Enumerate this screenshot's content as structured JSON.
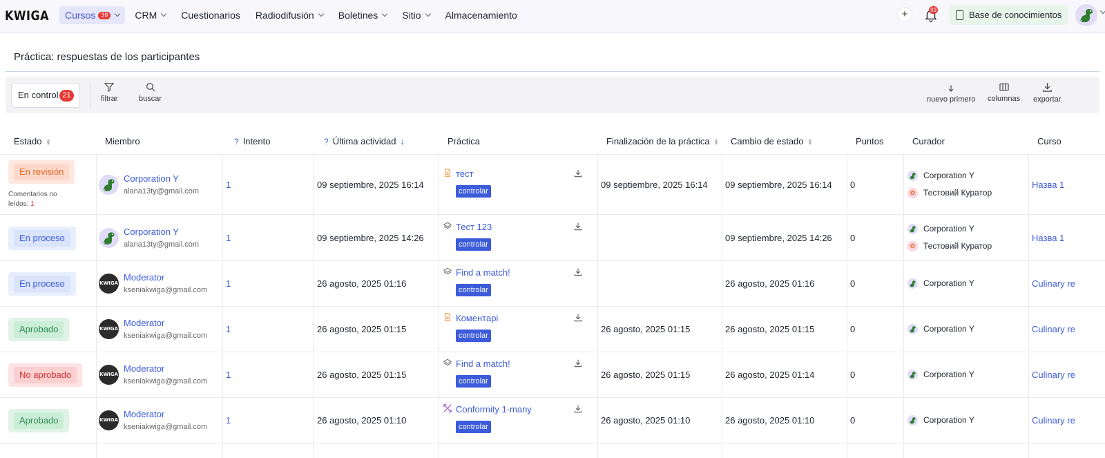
{
  "app": {
    "logo": "KWIGA"
  },
  "nav": {
    "items": [
      {
        "label": "Cursos",
        "badge": "39",
        "chevron": true,
        "active": true
      },
      {
        "label": "CRM",
        "chevron": true
      },
      {
        "label": "Cuestionarios",
        "chevron": false
      },
      {
        "label": "Radiodifusión",
        "chevron": true
      },
      {
        "label": "Boletines",
        "chevron": true
      },
      {
        "label": "Sitio",
        "chevron": true
      },
      {
        "label": "Almacenamiento",
        "chevron": false
      }
    ],
    "plus_label": "+",
    "bell_badge": "99",
    "knowledge_base": "Base de conocimientos"
  },
  "page": {
    "title": "Práctica: respuestas de los participantes"
  },
  "toolbar": {
    "filter_chip": "En control",
    "filter_chip_count": "21",
    "filter": "filtrar",
    "search": "buscar",
    "newest": "nuevo primero",
    "columns": "columnas",
    "export": "exportar"
  },
  "table": {
    "headers": {
      "estado": "Estado",
      "miembro": "Miembro",
      "q": "?",
      "intento": "Intento",
      "ultima": "Última actividad",
      "practica": "Práctica",
      "finalizacion": "Finalización de la práctica",
      "cambio": "Cambio de estado",
      "puntos": "Puntos",
      "curador": "Curador",
      "curso": "Curso"
    },
    "comments_label": "Comentarios no leídos:",
    "rows": [
      {
        "status": "En revisión",
        "status_kind": "review",
        "comments": "1",
        "member": "Corporation Y",
        "email": "alana13ty@gmail.com",
        "avatar": "dino",
        "attempt": "1",
        "last_activity": "09 septiembre, 2025 16:14",
        "practice": "тест",
        "practice_icon": "doc",
        "tag": "controlar",
        "finished": "09 septiembre, 2025 16:14",
        "status_change": "09 septiembre, 2025 16:14",
        "points": "0",
        "curators": [
          "Corporation Y",
          "Тестовий Куратор"
        ],
        "course": "Назва 1"
      },
      {
        "status": "En proceso",
        "status_kind": "proc",
        "member": "Corporation Y",
        "email": "alana13ty@gmail.com",
        "avatar": "dino",
        "attempt": "1",
        "last_activity": "09 septiembre, 2025 14:26",
        "practice": "Тест 123",
        "practice_icon": "layers",
        "tag": "controlar",
        "finished": "",
        "status_change": "09 septiembre, 2025 14:26",
        "points": "0",
        "curators": [
          "Corporation Y",
          "Тестовий Куратор"
        ],
        "course": "Назва 1"
      },
      {
        "status": "En proceso",
        "status_kind": "proc",
        "member": "Moderator",
        "email": "kseniakwiga@gmail.com",
        "avatar": "kwiga",
        "attempt": "1",
        "last_activity": "26 agosto, 2025 01:16",
        "practice": "Find a match!",
        "practice_icon": "layers",
        "tag": "controlar",
        "finished": "",
        "status_change": "26 agosto, 2025 01:16",
        "points": "0",
        "curators": [
          "Corporation Y"
        ],
        "course": "Culinary re"
      },
      {
        "status": "Aprobado",
        "status_kind": "ok",
        "member": "Moderator",
        "email": "kseniakwiga@gmail.com",
        "avatar": "kwiga",
        "attempt": "1",
        "last_activity": "26 agosto, 2025 01:15",
        "practice": "Коментарі",
        "practice_icon": "doc",
        "tag": "controlar",
        "finished": "26 agosto, 2025 01:15",
        "status_change": "26 agosto, 2025 01:15",
        "points": "0",
        "curators": [
          "Corporation Y"
        ],
        "course": "Culinary re"
      },
      {
        "status": "No aprobado",
        "status_kind": "no",
        "member": "Moderator",
        "email": "kseniakwiga@gmail.com",
        "avatar": "kwiga",
        "attempt": "1",
        "last_activity": "26 agosto, 2025 01:15",
        "practice": "Find a match!",
        "practice_icon": "layers",
        "tag": "controlar",
        "finished": "26 agosto, 2025 01:15",
        "status_change": "26 agosto, 2025 01:14",
        "points": "0",
        "curators": [
          "Corporation Y"
        ],
        "course": "Culinary re"
      },
      {
        "status": "Aprobado",
        "status_kind": "ok",
        "member": "Moderator",
        "email": "kseniakwiga@gmail.com",
        "avatar": "kwiga",
        "attempt": "1",
        "last_activity": "26 agosto, 2025 01:10",
        "practice": "Conformity 1-many",
        "practice_icon": "connect",
        "tag": "controlar",
        "finished": "26 agosto, 2025 01:10",
        "status_change": "26 agosto, 2025 01:10",
        "points": "0",
        "curators": [
          "Corporation Y"
        ],
        "course": "Culinary re"
      }
    ]
  },
  "colors": {
    "accent": "#3b5bdb",
    "badge": "#e53935"
  }
}
